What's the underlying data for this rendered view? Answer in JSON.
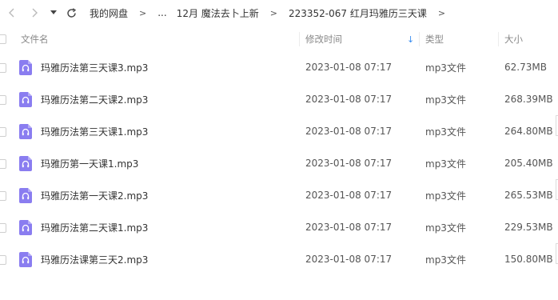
{
  "toolbar": {
    "back_icon": "chevron-left-icon",
    "forward_icon": "chevron-right-icon",
    "dropdown_icon": "caret-down-icon",
    "refresh_icon": "refresh-icon"
  },
  "breadcrumb": {
    "items": [
      "我的网盘",
      "...",
      "12月 魔法去卜上新",
      "223352-067 红月玛雅历三天课"
    ],
    "separator": ">"
  },
  "columns": {
    "name": "文件名",
    "date": "修改时间",
    "type": "类型",
    "size": "大小",
    "sort_indicator": "↓"
  },
  "files": [
    {
      "name": "玛雅历法第三天课3.mp3",
      "date": "2023-01-08 07:17",
      "type": "mp3文件",
      "size": "62.73MB"
    },
    {
      "name": "玛雅历法第二天课2.mp3",
      "date": "2023-01-08 07:17",
      "type": "mp3文件",
      "size": "268.39MB"
    },
    {
      "name": "玛雅历法第三天课1.mp3",
      "date": "2023-01-08 07:17",
      "type": "mp3文件",
      "size": "264.80MB"
    },
    {
      "name": "玛雅历第一天课1.mp3",
      "date": "2023-01-08 07:17",
      "type": "mp3文件",
      "size": "205.40MB"
    },
    {
      "name": "玛雅历法第一天课2.mp3",
      "date": "2023-01-08 07:17",
      "type": "mp3文件",
      "size": "265.53MB"
    },
    {
      "name": "玛雅历法第二天课1.mp3",
      "date": "2023-01-08 07:17",
      "type": "mp3文件",
      "size": "229.53MB"
    },
    {
      "name": "玛雅历法课第三天2.mp3",
      "date": "2023-01-08 07:17",
      "type": "mp3文件",
      "size": "150.80MB"
    }
  ],
  "colors": {
    "icon_purple": "#8a7df0",
    "sort_blue": "#3b8ef0"
  }
}
